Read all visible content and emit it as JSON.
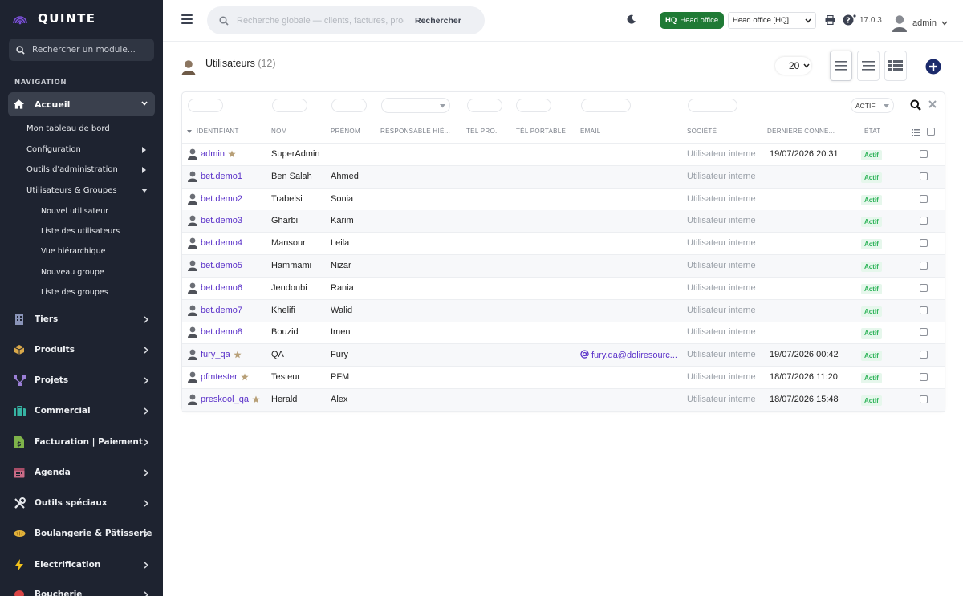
{
  "app": {
    "name": "QUINTE",
    "module_search_placeholder": "Rechercher un module..."
  },
  "nav": {
    "heading": "NAVIGATION",
    "active": "Accueil",
    "sub_items": [
      "Mon tableau de bord",
      "Configuration",
      "Outils d'administration",
      "Utilisateurs & Groupes"
    ],
    "sub_sub_items": [
      "Nouvel utilisateur",
      "Liste des utilisateurs",
      "Vue hiérarchique",
      "Nouveau groupe",
      "Liste des groupes"
    ],
    "menus": [
      {
        "label": "Tiers",
        "icon": "building-icon",
        "color": "#8a94b8"
      },
      {
        "label": "Produits",
        "icon": "box-icon",
        "color": "#d9a84a"
      },
      {
        "label": "Projets",
        "icon": "network-icon",
        "color": "#9b7fd6"
      },
      {
        "label": "Commercial",
        "icon": "briefcase-icon",
        "color": "#36b3a3"
      },
      {
        "label": "Facturation | Paiement",
        "icon": "invoice-icon",
        "color": "#7fb34a"
      },
      {
        "label": "Agenda",
        "icon": "calendar-icon",
        "color": "#c96b86"
      },
      {
        "label": "Outils spéciaux",
        "icon": "tools-icon",
        "color": "#e5e7eb"
      },
      {
        "label": "Boulangerie & Pâtisserie",
        "icon": "bread-icon",
        "color": "#e2b23a"
      },
      {
        "label": "Electrification",
        "icon": "bolt-icon",
        "color": "#f2c21b"
      },
      {
        "label": "Boucherie",
        "icon": "meat-icon",
        "color": "#d94444"
      }
    ]
  },
  "topbar": {
    "search_placeholder": "Recherche globale — clients, factures, prod",
    "search_button": "Rechercher",
    "entity_code": "HQ",
    "entity_name": "Head office",
    "entity_select": "Head office [HQ]",
    "version": "17.0.3",
    "user": "admin"
  },
  "page": {
    "title": "Utilisateurs",
    "count": "(12)",
    "per_page": "20",
    "status_filter": "ACTIF"
  },
  "table": {
    "headers": [
      "IDENTIFIANT",
      "NOM",
      "PRÉNOM",
      "RESPONSABLE HIÉ...",
      "TÉL PRO.",
      "TÉL PORTABLE",
      "EMAIL",
      "SOCIÉTÉ",
      "DERNIÈRE CONNE...",
      "ÉTAT"
    ],
    "rows": [
      {
        "login": "admin",
        "admin": true,
        "nom": "SuperAdmin",
        "prenom": "",
        "email": "",
        "societe": "Utilisateur interne",
        "last": "19/07/2026 20:31",
        "etat": "Actif"
      },
      {
        "login": "bet.demo1",
        "admin": false,
        "nom": "Ben Salah",
        "prenom": "Ahmed",
        "email": "",
        "societe": "Utilisateur interne",
        "last": "",
        "etat": "Actif"
      },
      {
        "login": "bet.demo2",
        "admin": false,
        "nom": "Trabelsi",
        "prenom": "Sonia",
        "email": "",
        "societe": "Utilisateur interne",
        "last": "",
        "etat": "Actif"
      },
      {
        "login": "bet.demo3",
        "admin": false,
        "nom": "Gharbi",
        "prenom": "Karim",
        "email": "",
        "societe": "Utilisateur interne",
        "last": "",
        "etat": "Actif"
      },
      {
        "login": "bet.demo4",
        "admin": false,
        "nom": "Mansour",
        "prenom": "Leila",
        "email": "",
        "societe": "Utilisateur interne",
        "last": "",
        "etat": "Actif"
      },
      {
        "login": "bet.demo5",
        "admin": false,
        "nom": "Hammami",
        "prenom": "Nizar",
        "email": "",
        "societe": "Utilisateur interne",
        "last": "",
        "etat": "Actif"
      },
      {
        "login": "bet.demo6",
        "admin": false,
        "nom": "Jendoubi",
        "prenom": "Rania",
        "email": "",
        "societe": "Utilisateur interne",
        "last": "",
        "etat": "Actif"
      },
      {
        "login": "bet.demo7",
        "admin": false,
        "nom": "Khelifi",
        "prenom": "Walid",
        "email": "",
        "societe": "Utilisateur interne",
        "last": "",
        "etat": "Actif"
      },
      {
        "login": "bet.demo8",
        "admin": false,
        "nom": "Bouzid",
        "prenom": "Imen",
        "email": "",
        "societe": "Utilisateur interne",
        "last": "",
        "etat": "Actif"
      },
      {
        "login": "fury_qa",
        "admin": true,
        "nom": "QA",
        "prenom": "Fury",
        "email": "fury.qa@doliresourc...",
        "societe": "Utilisateur interne",
        "last": "19/07/2026 00:42",
        "etat": "Actif"
      },
      {
        "login": "pfmtester",
        "admin": true,
        "nom": "Testeur",
        "prenom": "PFM",
        "email": "",
        "societe": "Utilisateur interne",
        "last": "18/07/2026 11:20",
        "etat": "Actif"
      },
      {
        "login": "preskool_qa",
        "admin": true,
        "nom": "Herald",
        "prenom": "Alex",
        "email": "",
        "societe": "Utilisateur interne",
        "last": "18/07/2026 15:48",
        "etat": "Actif"
      }
    ]
  },
  "colors": {
    "sidebar": "#1e2330",
    "accent": "#5a31c9",
    "hq_green": "#1f7a35",
    "status_green": "#2fb45a",
    "add_button": "#1b2a6b"
  }
}
